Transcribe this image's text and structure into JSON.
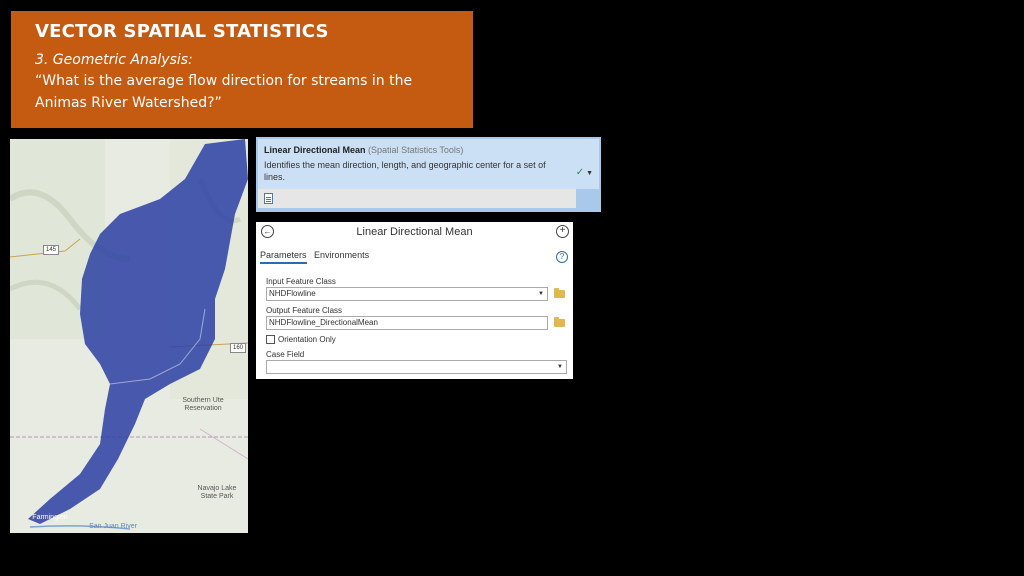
{
  "slide": {
    "heading": "VECTOR SPATIAL STATISTICS",
    "subheading": "3. Geometric Analysis:",
    "question": "“What is the average flow direction for streams in the Animas River Watershed?”",
    "colors": {
      "title_bg": "#c55a11",
      "background": "#000000"
    }
  },
  "map": {
    "labels": {
      "hwy_145": "145",
      "hwy_160": "160",
      "reservation": "Southern Ute Reservation",
      "park": "Navajo Lake State Park",
      "city": "Farmington",
      "river": "San Juan River",
      "hwy_550": "550"
    },
    "stream_color": "#2c3fa3"
  },
  "search_result": {
    "tool_name": "Linear Directional Mean",
    "category": "(Spatial Statistics Tools)",
    "description": "Identifies the mean direction, length, and geographic center for a set of lines.",
    "check_icon": "check-icon",
    "doc_icon": "script-icon"
  },
  "geoprocessing": {
    "title": "Linear Directional Mean",
    "tabs": [
      "Parameters",
      "Environments"
    ],
    "input_label": "Input Feature Class",
    "input_value": "NHDFlowline",
    "output_label": "Output Feature Class",
    "output_value": "NHDFlowline_DirectionalMean",
    "orientation_label": "Orientation Only",
    "orientation_checked": false,
    "case_label": "Case Field",
    "case_value": ""
  }
}
